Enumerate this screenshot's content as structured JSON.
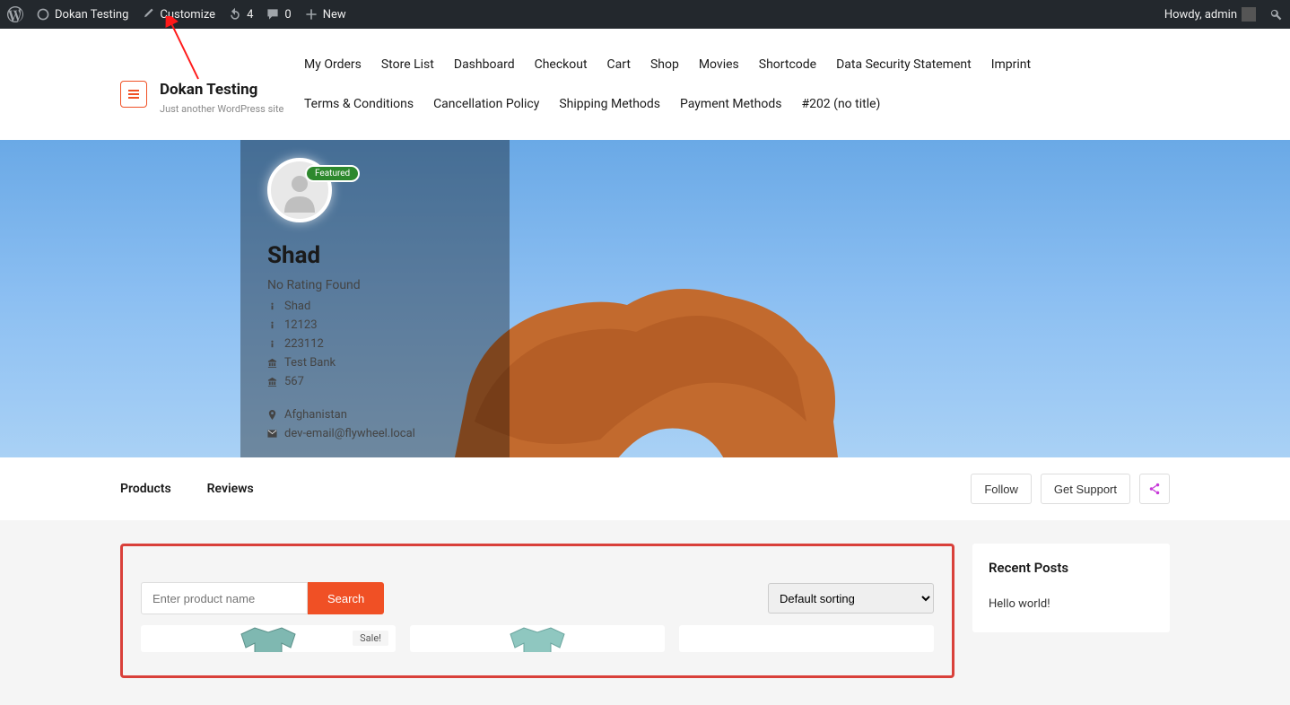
{
  "adminbar": {
    "site_name": "Dokan Testing",
    "customize": "Customize",
    "updates": "4",
    "comments": "0",
    "new": "New",
    "howdy": "Howdy, admin"
  },
  "branding": {
    "title": "Dokan Testing",
    "tagline": "Just another WordPress site"
  },
  "nav": {
    "items": [
      "My Orders",
      "Store List",
      "Dashboard",
      "Checkout",
      "Cart",
      "Shop",
      "Movies",
      "Shortcode",
      "Data Security Statement",
      "Imprint",
      "Terms & Conditions",
      "Cancellation Policy",
      "Shipping Methods",
      "Payment Methods",
      "#202 (no title)"
    ]
  },
  "store": {
    "featured": "Featured",
    "name": "Shad",
    "no_rating": "No Rating Found",
    "info1": "Shad",
    "info2": "12123",
    "info3": "223112",
    "bank1": "Test Bank",
    "bank2": "567",
    "location": "Afghanistan",
    "email": "dev-email@flywheel.local"
  },
  "tabs": {
    "products": "Products",
    "reviews": "Reviews",
    "follow": "Follow",
    "support": "Get Support"
  },
  "search": {
    "placeholder": "Enter product name",
    "button": "Search"
  },
  "sort": {
    "selected": "Default sorting"
  },
  "products": {
    "sale": "Sale!"
  },
  "sidebar": {
    "title": "Recent Posts",
    "link1": "Hello world!"
  }
}
